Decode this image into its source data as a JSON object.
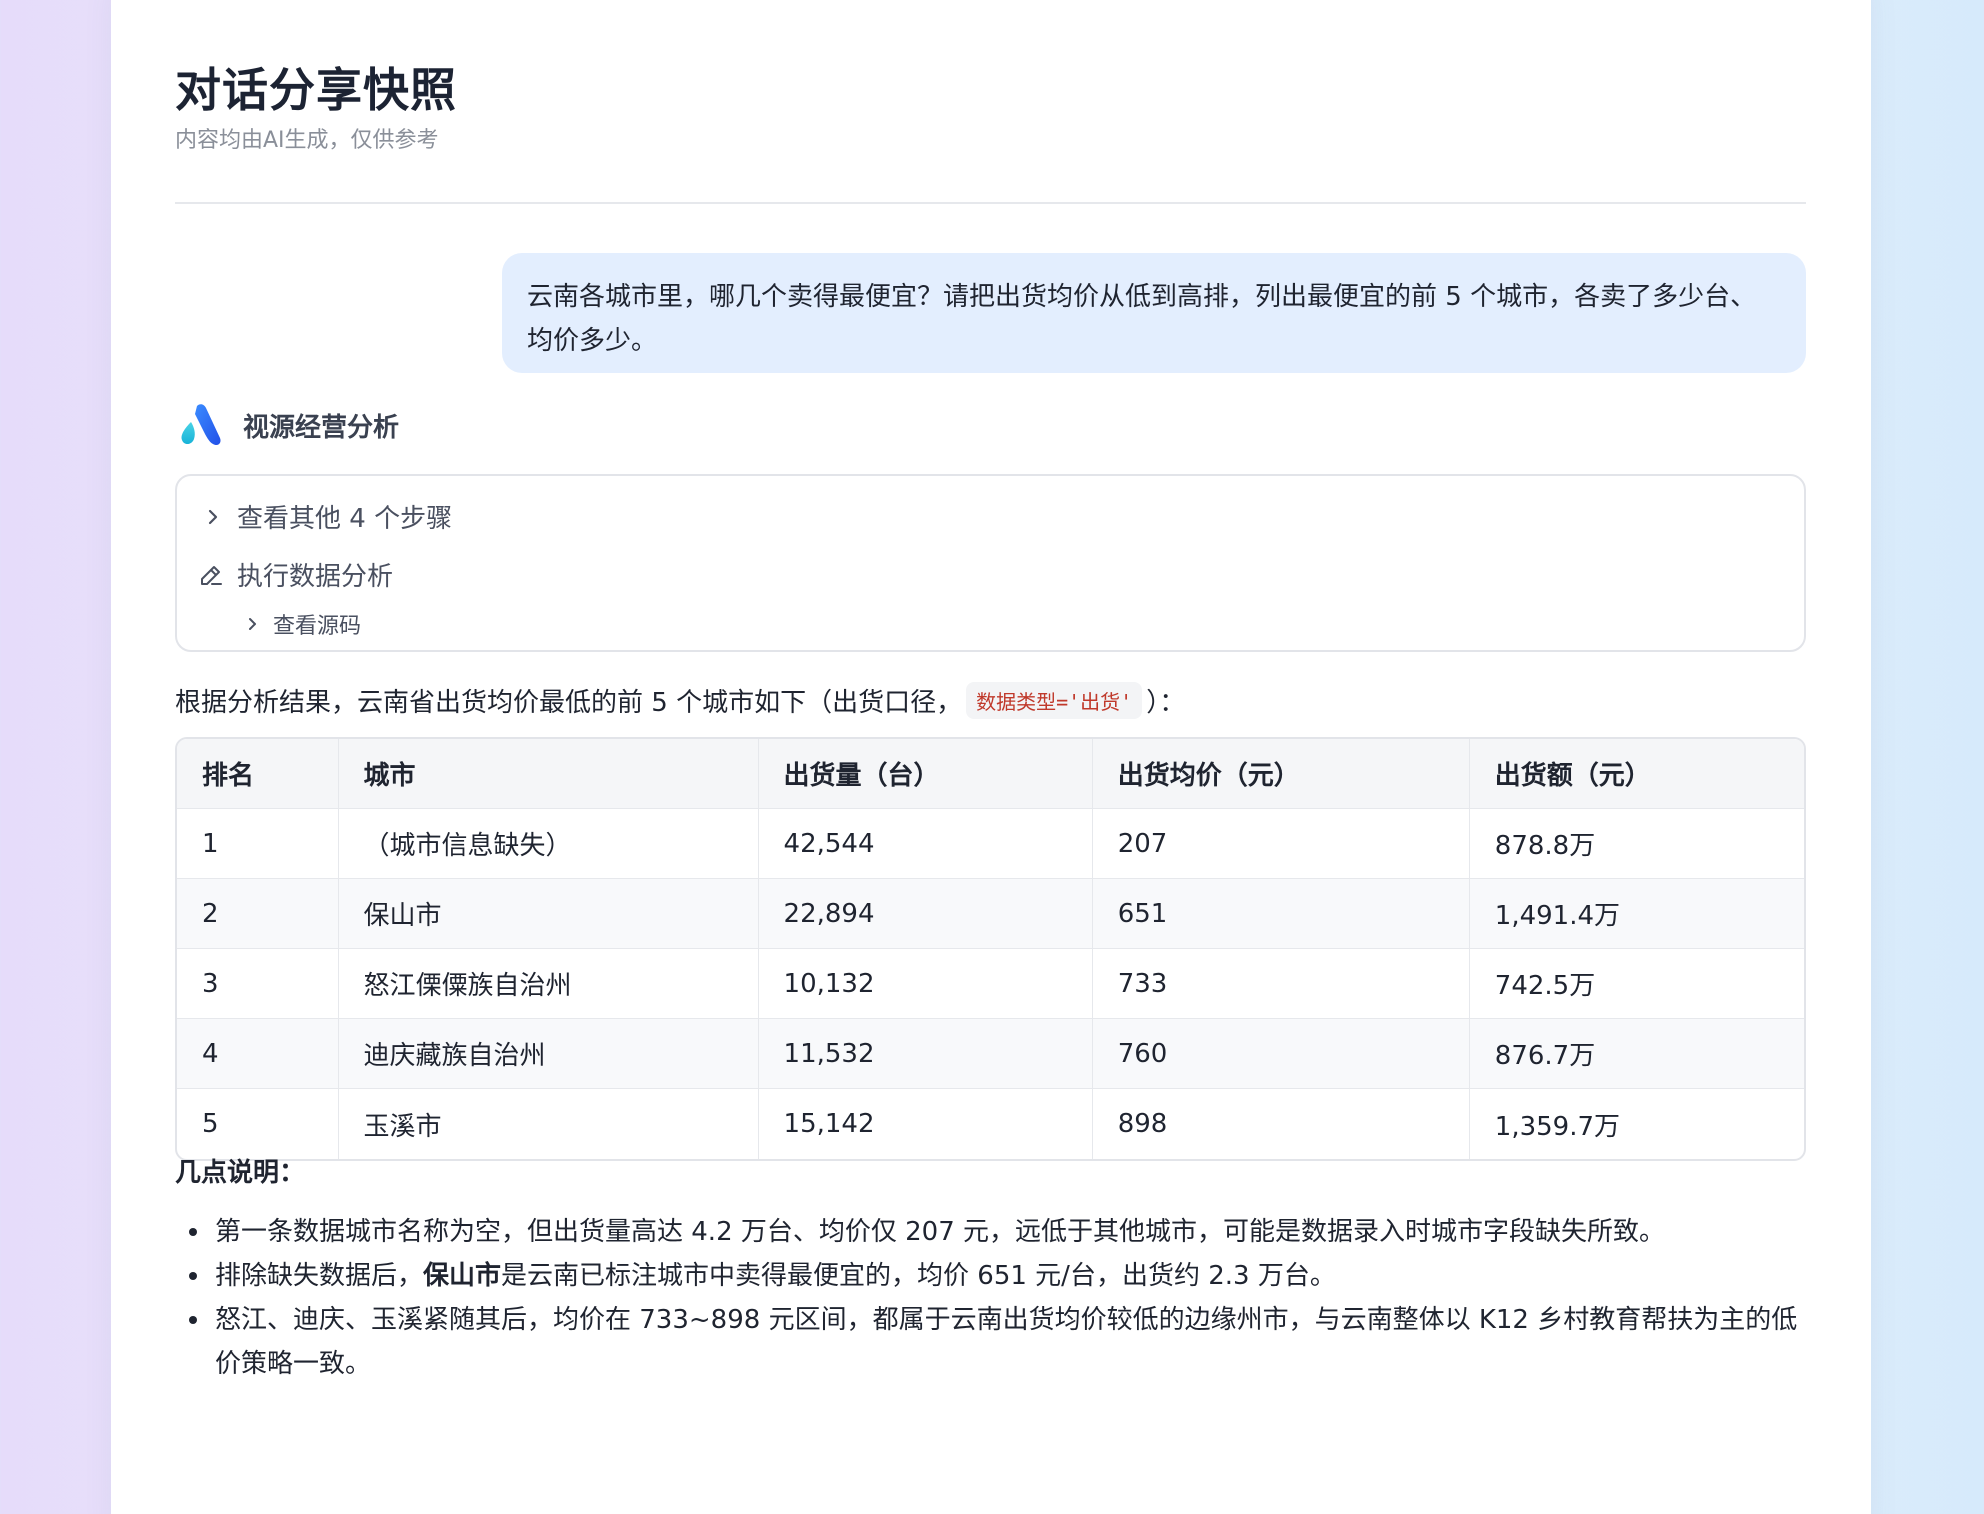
{
  "page": {
    "title": "对话分享快照",
    "subtitle": "内容均由AI生成，仅供参考"
  },
  "user_message": "云南各城市里，哪几个卖得最便宜？请把出货均价从低到高排，列出最便宜的前 5 个城市，各卖了多少台、均价多少。",
  "assistant": {
    "name": "视源经营分析",
    "logo_icon": "brand-logo-icon",
    "steps": {
      "toggle_label": "查看其他 4 个步骤",
      "step_label": "执行数据分析",
      "source_label": "查看源码"
    },
    "intro_before": "根据分析结果，云南省出货均价最低的前 5 个城市如下（出货口径，",
    "intro_code": "数据类型='出货'",
    "intro_after": "）：",
    "table": {
      "headers": [
        "排名",
        "城市",
        "出货量（台）",
        "出货均价（元）",
        "出货额（元）"
      ],
      "rows": [
        [
          "1",
          "（城市信息缺失）",
          "42,544",
          "207",
          "878.8万"
        ],
        [
          "2",
          "保山市",
          "22,894",
          "651",
          "1,491.4万"
        ],
        [
          "3",
          "怒江傈僳族自治州",
          "10,132",
          "733",
          "742.5万"
        ],
        [
          "4",
          "迪庆藏族自治州",
          "11,532",
          "760",
          "876.7万"
        ],
        [
          "5",
          "玉溪市",
          "15,142",
          "898",
          "1,359.7万"
        ]
      ]
    },
    "notes_title": "几点说明：",
    "notes": [
      {
        "text": "第一条数据城市名称为空，但出货量高达 4.2 万台、均价仅 207 元，远低于其他城市，可能是数据录入时城市字段缺失所致。"
      },
      {
        "pre": "排除缺失数据后，",
        "bold": "保山市",
        "post": "是云南已标注城市中卖得最便宜的，均价 651 元/台，出货约 2.3 万台。"
      },
      {
        "text": "怒江、迪庆、玉溪紧随其后，均价在 733~898 元区间，都属于云南出货均价较低的边缘州市，与云南整体以 K12 乡村教育帮扶为主的低价策略一致。"
      }
    ]
  }
}
